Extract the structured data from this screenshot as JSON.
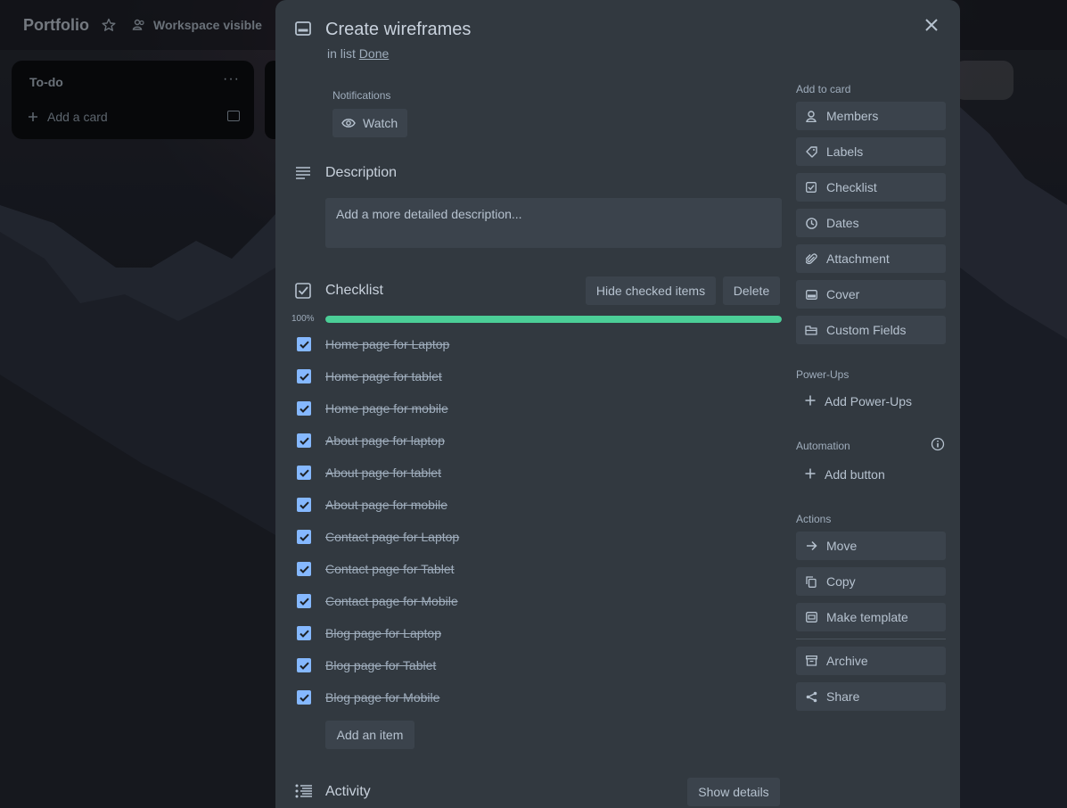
{
  "board": {
    "title": "Portfolio",
    "visibility": "Workspace visible",
    "lists": [
      {
        "title": "To-do",
        "add_card": "Add a card"
      }
    ]
  },
  "card": {
    "title": "Create wireframes",
    "in_list_prefix": "in list",
    "list_name": "Done",
    "notifications_label": "Notifications",
    "watch_label": "Watch",
    "description": {
      "title": "Description",
      "placeholder": "Add a more detailed description..."
    },
    "checklist": {
      "title": "Checklist",
      "hide_checked_label": "Hide checked items",
      "delete_label": "Delete",
      "progress_text": "100%",
      "progress": 1.0,
      "items": [
        {
          "text": "Home page for Laptop",
          "checked": true
        },
        {
          "text": "Home page for tablet",
          "checked": true
        },
        {
          "text": "Home page for mobile",
          "checked": true
        },
        {
          "text": "About page for laptop",
          "checked": true
        },
        {
          "text": "About page for tablet",
          "checked": true
        },
        {
          "text": "About page for mobile",
          "checked": true
        },
        {
          "text": "Contact page for Laptop",
          "checked": true
        },
        {
          "text": "Contact page for Tablet",
          "checked": true
        },
        {
          "text": "Contact page for Mobile",
          "checked": true
        },
        {
          "text": "Blog page for Laptop",
          "checked": true
        },
        {
          "text": "Blog page for Tablet",
          "checked": true
        },
        {
          "text": "Blog page for Mobile",
          "checked": true
        }
      ],
      "add_item_label": "Add an item"
    },
    "activity": {
      "title": "Activity",
      "show_details_label": "Show details"
    }
  },
  "sidebar": {
    "add_to_card_label": "Add to card",
    "add_to_card": [
      {
        "label": "Members",
        "icon": "person-icon"
      },
      {
        "label": "Labels",
        "icon": "tag-icon"
      },
      {
        "label": "Checklist",
        "icon": "checkbox-icon"
      },
      {
        "label": "Dates",
        "icon": "clock-icon"
      },
      {
        "label": "Attachment",
        "icon": "paperclip-icon"
      },
      {
        "label": "Cover",
        "icon": "cover-icon"
      },
      {
        "label": "Custom Fields",
        "icon": "custom-fields-icon"
      }
    ],
    "powerups_label": "Power-Ups",
    "add_powerups_label": "Add Power-Ups",
    "automation_label": "Automation",
    "add_button_label": "Add button",
    "actions_label": "Actions",
    "actions": [
      {
        "label": "Move",
        "icon": "arrow-right-icon"
      },
      {
        "label": "Copy",
        "icon": "copy-icon"
      },
      {
        "label": "Make template",
        "icon": "template-icon"
      },
      {
        "label": "Archive",
        "icon": "archive-icon"
      },
      {
        "label": "Share",
        "icon": "share-icon"
      }
    ]
  },
  "colors": {
    "modal_bg": "#323940",
    "button_bg": "#3b434c",
    "progress": "#4bce97",
    "checkbox": "#85b8ff"
  }
}
